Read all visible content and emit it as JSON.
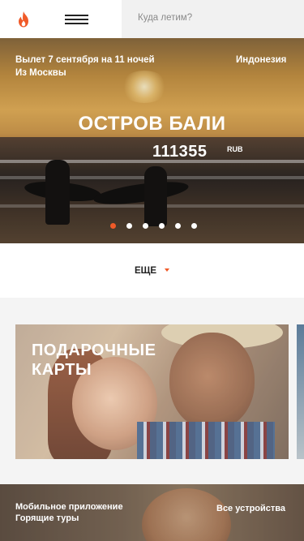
{
  "header": {
    "search_placeholder": "Куда летим?",
    "logo_icon": "flame-icon",
    "menu_icon": "hamburger-menu-icon",
    "brand_color": "#f05a28"
  },
  "hero": {
    "departure": "Вылет 7 сентября на 11 ночей",
    "origin": "Из Москвы",
    "country": "Индонезия",
    "title": "ОСТРОВ БАЛИ",
    "price": "111355",
    "currency": "RUB",
    "slides_total": 6,
    "active_slide": 1
  },
  "more": {
    "label": "ЕЩЕ",
    "caret_icon": "caret-down-icon"
  },
  "gift": {
    "line1": "ПОДАРОЧНЫЕ",
    "line2": "КАРТЫ"
  },
  "bottom": {
    "line1": "Мобильное приложение",
    "line2": "Горящие туры",
    "link": "Все устройства"
  }
}
